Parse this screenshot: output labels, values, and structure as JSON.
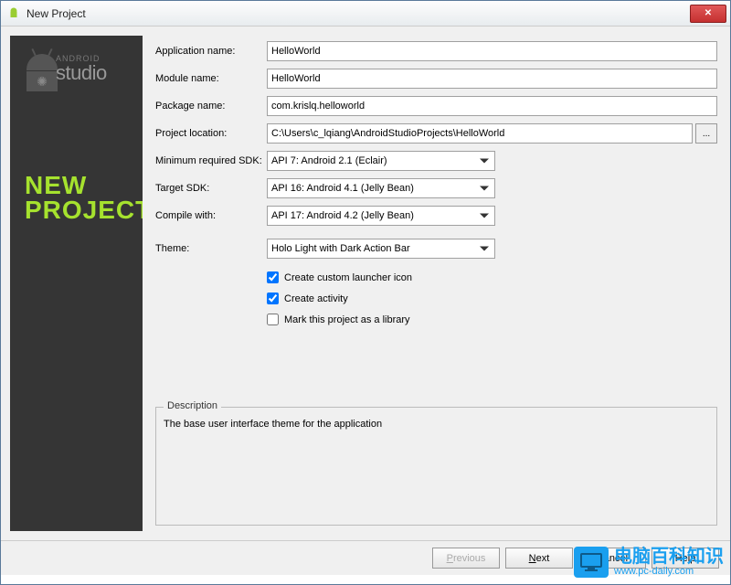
{
  "window": {
    "title": "New Project"
  },
  "sidebar": {
    "brand_small": "ANDROID",
    "brand": "studio",
    "heading_line1": "NEW",
    "heading_line2": "PROJECT"
  },
  "form": {
    "app_name": {
      "label": "Application name:",
      "value": "HelloWorld"
    },
    "module_name": {
      "label": "Module name:",
      "value": "HelloWorld"
    },
    "package_name": {
      "label": "Package name:",
      "value": "com.krislq.helloworld"
    },
    "location": {
      "label": "Project location:",
      "value": "C:\\Users\\c_lqiang\\AndroidStudioProjects\\HelloWorld",
      "browse": "..."
    },
    "min_sdk": {
      "label": "Minimum required SDK:",
      "value": "API 7: Android 2.1 (Eclair)"
    },
    "target_sdk": {
      "label": "Target SDK:",
      "value": "API 16: Android 4.1 (Jelly Bean)"
    },
    "compile_with": {
      "label": "Compile with:",
      "value": "API 17: Android 4.2 (Jelly Bean)"
    },
    "theme": {
      "label": "Theme:",
      "value": "Holo Light with Dark Action Bar"
    },
    "chk_launcher": {
      "label": "Create custom launcher icon",
      "checked": true
    },
    "chk_activity": {
      "label": "Create activity",
      "checked": true
    },
    "chk_library": {
      "label": "Mark this project as a library",
      "checked": false
    }
  },
  "description": {
    "title": "Description",
    "text": "The base user interface theme for the application"
  },
  "buttons": {
    "previous": "Previous",
    "next": "Next",
    "cancel": "Cancel",
    "help": "Help"
  },
  "watermark": {
    "big": "电脑百科知识",
    "url": "www.pc-daily.com"
  }
}
